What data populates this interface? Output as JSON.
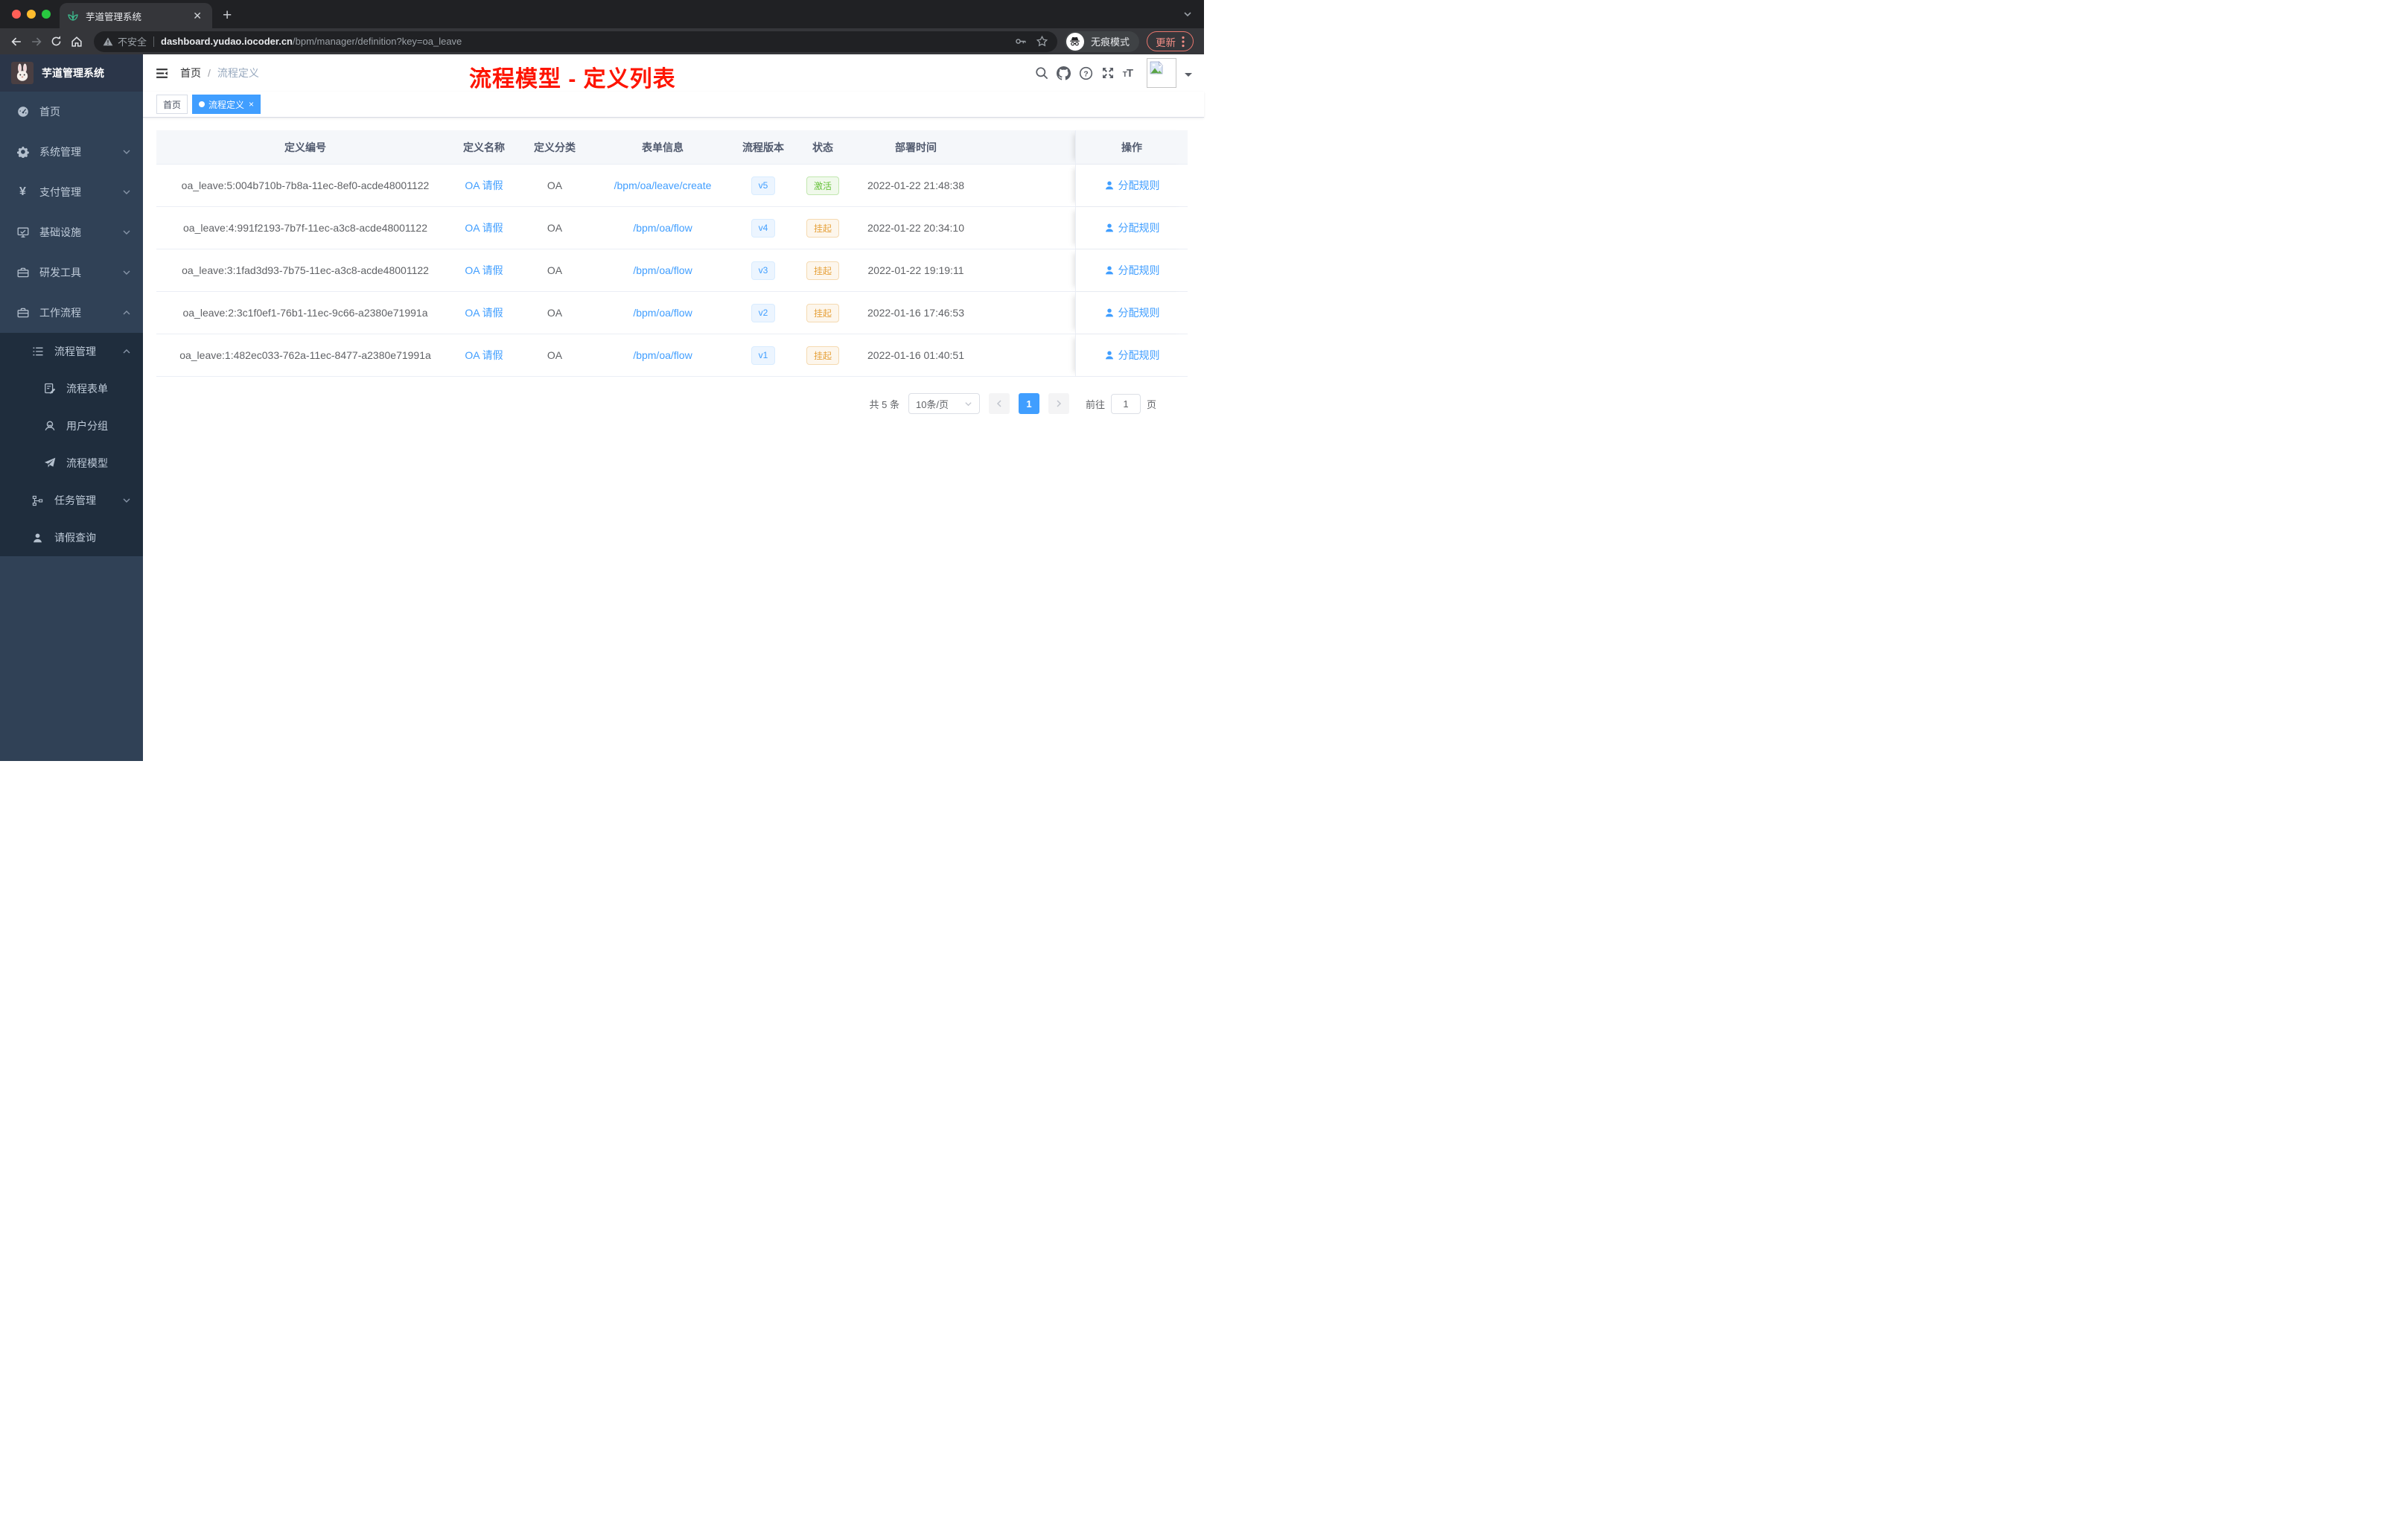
{
  "browser": {
    "tab_title": "芋道管理系统",
    "security_label": "不安全",
    "url_host": "dashboard.yudao.iocoder.cn",
    "url_path": "/bpm/manager/definition?key=oa_leave",
    "incognito_label": "无痕模式",
    "update_label": "更新"
  },
  "sidebar": {
    "title": "芋道管理系统",
    "menu": [
      {
        "label": "首页"
      },
      {
        "label": "系统管理"
      },
      {
        "label": "支付管理"
      },
      {
        "label": "基础设施"
      },
      {
        "label": "研发工具"
      },
      {
        "label": "工作流程"
      },
      {
        "label": "流程管理"
      },
      {
        "label": "流程表单"
      },
      {
        "label": "用户分组"
      },
      {
        "label": "流程模型"
      },
      {
        "label": "任务管理"
      },
      {
        "label": "请假查询"
      }
    ]
  },
  "navbar": {
    "breadcrumb_home": "首页",
    "breadcrumb_sep": "/",
    "breadcrumb_current": "流程定义"
  },
  "annotation": "流程模型 - 定义列表",
  "tags": [
    {
      "label": "首页"
    },
    {
      "label": "流程定义"
    }
  ],
  "table": {
    "columns": [
      "定义编号",
      "定义名称",
      "定义分类",
      "表单信息",
      "流程版本",
      "状态",
      "部署时间",
      "操作"
    ],
    "action_label": "分配规则",
    "rows": [
      {
        "id": "oa_leave:5:004b710b-7b8a-11ec-8ef0-acde48001122",
        "name": "OA 请假",
        "category": "OA",
        "form": "/bpm/oa/leave/create",
        "version": "v5",
        "status": "激活",
        "deployed_at": "2022-01-22 21:48:38"
      },
      {
        "id": "oa_leave:4:991f2193-7b7f-11ec-a3c8-acde48001122",
        "name": "OA 请假",
        "category": "OA",
        "form": "/bpm/oa/flow",
        "version": "v4",
        "status": "挂起",
        "deployed_at": "2022-01-22 20:34:10"
      },
      {
        "id": "oa_leave:3:1fad3d93-7b75-11ec-a3c8-acde48001122",
        "name": "OA 请假",
        "category": "OA",
        "form": "/bpm/oa/flow",
        "version": "v3",
        "status": "挂起",
        "deployed_at": "2022-01-22 19:19:11"
      },
      {
        "id": "oa_leave:2:3c1f0ef1-76b1-11ec-9c66-a2380e71991a",
        "name": "OA 请假",
        "category": "OA",
        "form": "/bpm/oa/flow",
        "version": "v2",
        "status": "挂起",
        "deployed_at": "2022-01-16 17:46:53"
      },
      {
        "id": "oa_leave:1:482ec033-762a-11ec-8477-a2380e71991a",
        "name": "OA 请假",
        "category": "OA",
        "form": "/bpm/oa/flow",
        "version": "v1",
        "status": "挂起",
        "deployed_at": "2022-01-16 01:40:51"
      }
    ]
  },
  "pagination": {
    "total": "共 5 条",
    "page_size": "10条/页",
    "page": "1",
    "goto": "前往",
    "unit": "页"
  },
  "colors": {
    "accent": "#409eff",
    "success": "#67c23a",
    "warning": "#e6a23c",
    "sidebar_bg": "#304156",
    "submenu_bg": "#1f2d3d",
    "annotation_red": "#fe1400"
  }
}
